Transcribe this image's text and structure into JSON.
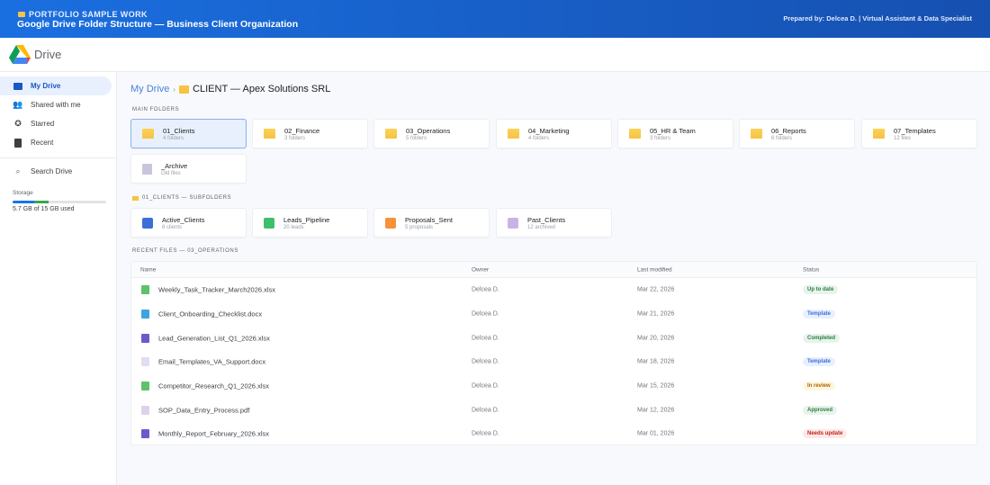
{
  "banner": {
    "kicker": "PORTFOLIO SAMPLE WORK",
    "title": "Google Drive Folder Structure — Business Client Organization",
    "prepared": "Prepared by: Delcea D. | Virtual Assistant & Data Specialist"
  },
  "app": {
    "name": "Drive"
  },
  "sidebar": {
    "items": [
      {
        "label": "My Drive",
        "icon": "folder-icon"
      },
      {
        "label": "Shared with me",
        "icon": "people-icon"
      },
      {
        "label": "Starred",
        "icon": "star-icon"
      },
      {
        "label": "Recent",
        "icon": "file-icon"
      }
    ],
    "search": "Search Drive",
    "storage_label": "Storage",
    "storage_value": "5.7 GB of 15 GB used",
    "storage_fraction": 0.38
  },
  "breadcrumb": {
    "root": "My Drive",
    "current": "CLIENT — Apex Solutions SRL"
  },
  "main_folders": {
    "label": "MAIN FOLDERS",
    "items": [
      {
        "name": "01_Clients",
        "sub": "4 folders"
      },
      {
        "name": "02_Finance",
        "sub": "3 folders"
      },
      {
        "name": "03_Operations",
        "sub": "5 folders"
      },
      {
        "name": "04_Marketing",
        "sub": "4 folders"
      },
      {
        "name": "05_HR & Team",
        "sub": "3 folders"
      },
      {
        "name": "06_Reports",
        "sub": "6 folders"
      },
      {
        "name": "07_Templates",
        "sub": "12 files"
      },
      {
        "name": "_Archive",
        "sub": "Old files"
      }
    ]
  },
  "subfolders": {
    "label": "01_CLIENTS — SUBFOLDERS",
    "items": [
      {
        "name": "Active_Clients",
        "sub": "8 clients",
        "color": "#3b6fd8"
      },
      {
        "name": "Leads_Pipeline",
        "sub": "20 leads",
        "color": "#3cc06a"
      },
      {
        "name": "Proposals_Sent",
        "sub": "5 proposals",
        "color": "#f7913a"
      },
      {
        "name": "Past_Clients",
        "sub": "12 archived",
        "color": "#c9b3e6"
      }
    ]
  },
  "recent": {
    "label": "RECENT FILES — 03_OPERATIONS",
    "columns": [
      "Name",
      "Owner",
      "Last modified",
      "Status"
    ],
    "rows": [
      {
        "name": "Weekly_Task_Tracker_March2026.xlsx",
        "owner": "Delcea D.",
        "modified": "Mar 22, 2026",
        "status": "Up to date",
        "icon": "#5dc26b",
        "bg": "#e6f4ea",
        "fg": "#2e7d46"
      },
      {
        "name": "Client_Onboarding_Checklist.docx",
        "owner": "Delcea D.",
        "modified": "Mar 21, 2026",
        "status": "Template",
        "icon": "#3ea3e0",
        "bg": "#e8f0fe",
        "fg": "#3b6fd8"
      },
      {
        "name": "Lead_Generation_List_Q1_2026.xlsx",
        "owner": "Delcea D.",
        "modified": "Mar 20, 2026",
        "status": "Completed",
        "icon": "#6a5acd",
        "bg": "#e6f4ea",
        "fg": "#2e7d46"
      },
      {
        "name": "Email_Templates_VA_Support.docx",
        "owner": "Delcea D.",
        "modified": "Mar 18, 2026",
        "status": "Template",
        "icon": "#e3dcef",
        "bg": "#e8f0fe",
        "fg": "#3b6fd8"
      },
      {
        "name": "Competitor_Research_Q1_2026.xlsx",
        "owner": "Delcea D.",
        "modified": "Mar 15, 2026",
        "status": "In review",
        "icon": "#5dc26b",
        "bg": "#fef7e0",
        "fg": "#b06000"
      },
      {
        "name": "SOP_Data_Entry_Process.pdf",
        "owner": "Delcea D.",
        "modified": "Mar 12, 2026",
        "status": "Approved",
        "icon": "#dcd3ea",
        "bg": "#e6f4ea",
        "fg": "#2e7d46"
      },
      {
        "name": "Monthly_Report_February_2026.xlsx",
        "owner": "Delcea D.",
        "modified": "Mar 01, 2026",
        "status": "Needs update",
        "icon": "#6a5acd",
        "bg": "#fce8e6",
        "fg": "#c5221f"
      }
    ]
  }
}
